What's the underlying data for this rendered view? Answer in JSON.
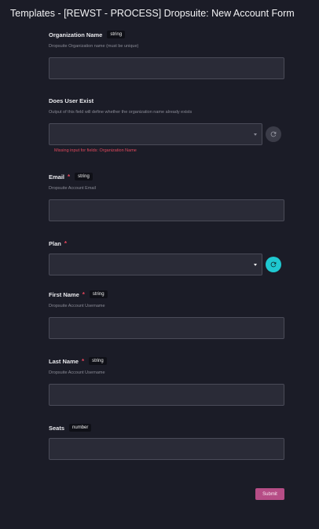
{
  "title": "Templates - [REWST - PROCESS] Dropsuite: New Account Form",
  "fields": {
    "org_name": {
      "label": "Organization Name",
      "type_tag": "string",
      "description": "Dropsuite Organization name (must be unique)",
      "value": ""
    },
    "user_exists": {
      "label": "Does User Exist",
      "description": "Output of this field will define whether the organization name already exists",
      "error": "Missing input for fields: Organization Name"
    },
    "email": {
      "label": "Email",
      "required_mark": "*",
      "type_tag": "string",
      "description": "Dropsuite Account Email",
      "value": ""
    },
    "plan": {
      "label": "Plan",
      "required_mark": "*"
    },
    "first_name": {
      "label": "First Name",
      "required_mark": "*",
      "type_tag": "string",
      "description": "Dropsuite Account Username",
      "value": ""
    },
    "last_name": {
      "label": "Last Name",
      "required_mark": "*",
      "type_tag": "string",
      "description": "Dropsuite Account Username",
      "value": ""
    },
    "seats": {
      "label": "Seats",
      "type_tag": "number",
      "value": ""
    }
  },
  "submit_label": "Submit",
  "colors": {
    "background": "#1b1c27",
    "input_bg": "#2a2b37",
    "required": "#e5445b",
    "refresh_active": "#1fc8d0",
    "submit": "#b64d86"
  },
  "icons": {
    "refresh": "refresh-icon",
    "dropdown": "chevron-down-icon"
  }
}
